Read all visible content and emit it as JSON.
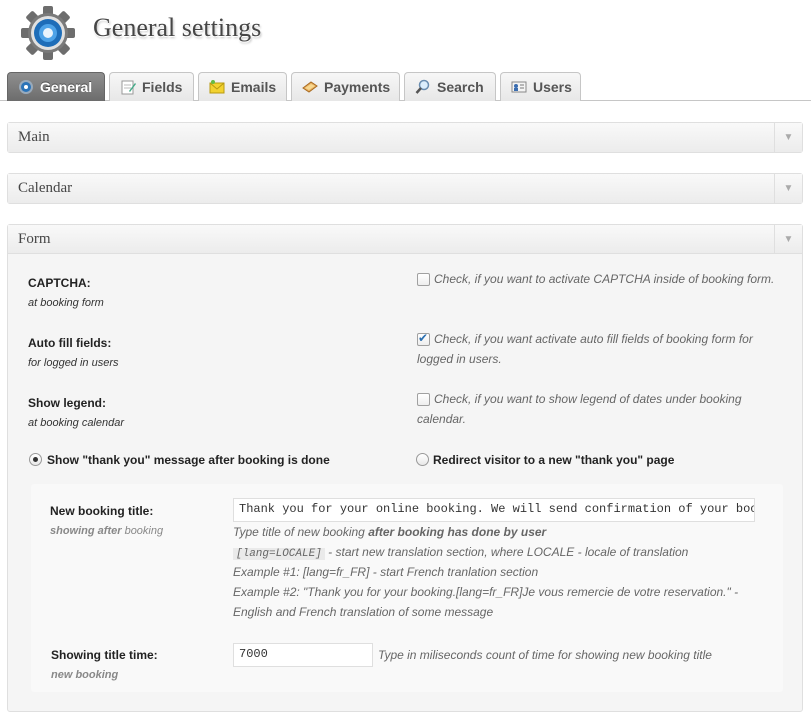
{
  "header": {
    "title": "General settings",
    "icon": "gear-icon"
  },
  "tabs": [
    {
      "label": "General",
      "icon": "gear-icon",
      "active": true
    },
    {
      "label": "Fields",
      "icon": "edit-icon"
    },
    {
      "label": "Emails",
      "icon": "envelope-icon"
    },
    {
      "label": "Payments",
      "icon": "payment-icon"
    },
    {
      "label": "Search",
      "icon": "search-icon"
    },
    {
      "label": "Users",
      "icon": "user-card-icon"
    }
  ],
  "sections": {
    "main": {
      "title": "Main"
    },
    "calendar": {
      "title": "Calendar"
    },
    "form": {
      "title": "Form"
    }
  },
  "form": {
    "captcha": {
      "label": "CAPTCHA:",
      "sub": "at booking form",
      "checked": false,
      "desc": "Check, if you want to activate CAPTCHA inside of booking form."
    },
    "autofill": {
      "label": "Auto fill fields:",
      "sub": "for logged in users",
      "checked": true,
      "desc_line1": "Check, if you want activate auto fill fields of booking form for",
      "desc_line2": "logged in users."
    },
    "legend": {
      "label": "Show legend:",
      "sub": "at booking calendar",
      "checked": false,
      "desc_line1": "Check, if you want to show legend of dates under booking",
      "desc_line2": "calendar."
    },
    "radio_thankyou": {
      "label": "Show \"thank you\" message after booking is done",
      "selected": true
    },
    "radio_redirect": {
      "label": "Redirect visitor to a new \"thank you\" page",
      "selected": false
    },
    "booking_title": {
      "label": "New booking title:",
      "sub_a": "showing after",
      "sub_b": " booking",
      "value": "Thank you for your online booking.  We will send confirmation of your booking as soon as possible.",
      "help_a": "Type title of new booking ",
      "help_b": "after booking has done by user",
      "lang_code": "[lang=LOCALE]",
      "lang_desc": " - start new translation section, where LOCALE - locale of translation",
      "example1": "Example #1: [lang=fr_FR] - start French tranlation section",
      "example2_line1": "Example #2: \"Thank you for your booking.[lang=fr_FR]Je vous remercie de votre reservation.\" -",
      "example2_line2": "English and French translation of some message"
    },
    "title_time": {
      "label": "Showing title time:",
      "sub": "new booking",
      "value": "7000",
      "help": "Type in miliseconds count of time for showing new booking title"
    }
  }
}
